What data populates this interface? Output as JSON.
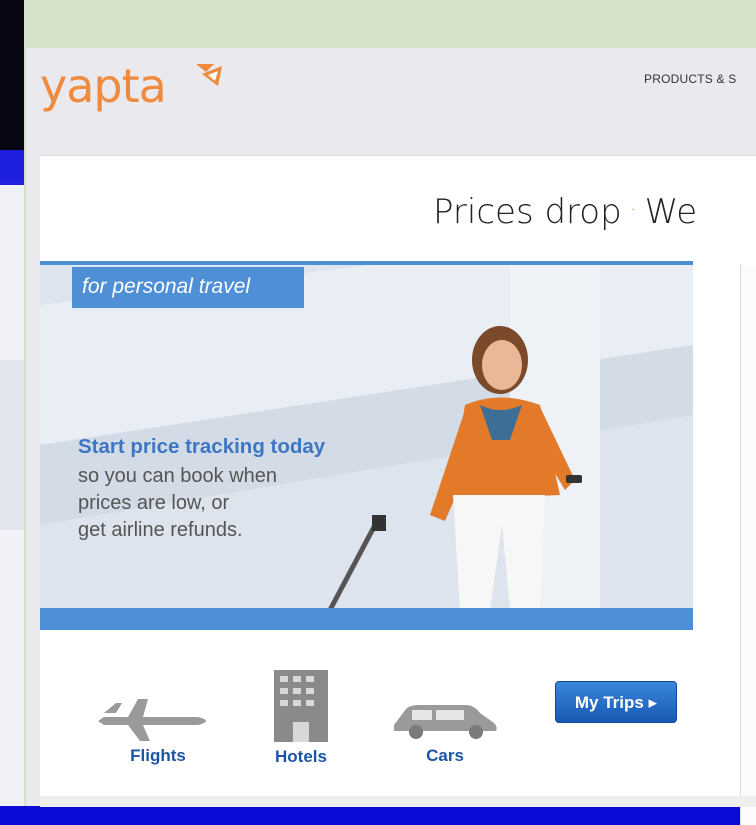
{
  "header": {
    "logo_text": "yapta",
    "nav_label": "PRODUCTS & S"
  },
  "main": {
    "headline_left": "Prices drop",
    "headline_dot": "·",
    "headline_right": "We"
  },
  "hero": {
    "tag": "for personal travel",
    "heading": "Start price tracking today",
    "lines": [
      "so you can book when",
      "prices are low, or",
      "get airline refunds."
    ]
  },
  "categories": [
    {
      "label": "Flights",
      "icon": "airplane-icon"
    },
    {
      "label": "Hotels",
      "icon": "hotel-building-icon"
    },
    {
      "label": "Cars",
      "icon": "car-icon"
    }
  ],
  "my_trips": {
    "label": "My Trips ▸"
  },
  "colors": {
    "brand_orange": "#f08a3c",
    "accent_blue": "#4e8fd6",
    "link_blue": "#1d55a6"
  }
}
